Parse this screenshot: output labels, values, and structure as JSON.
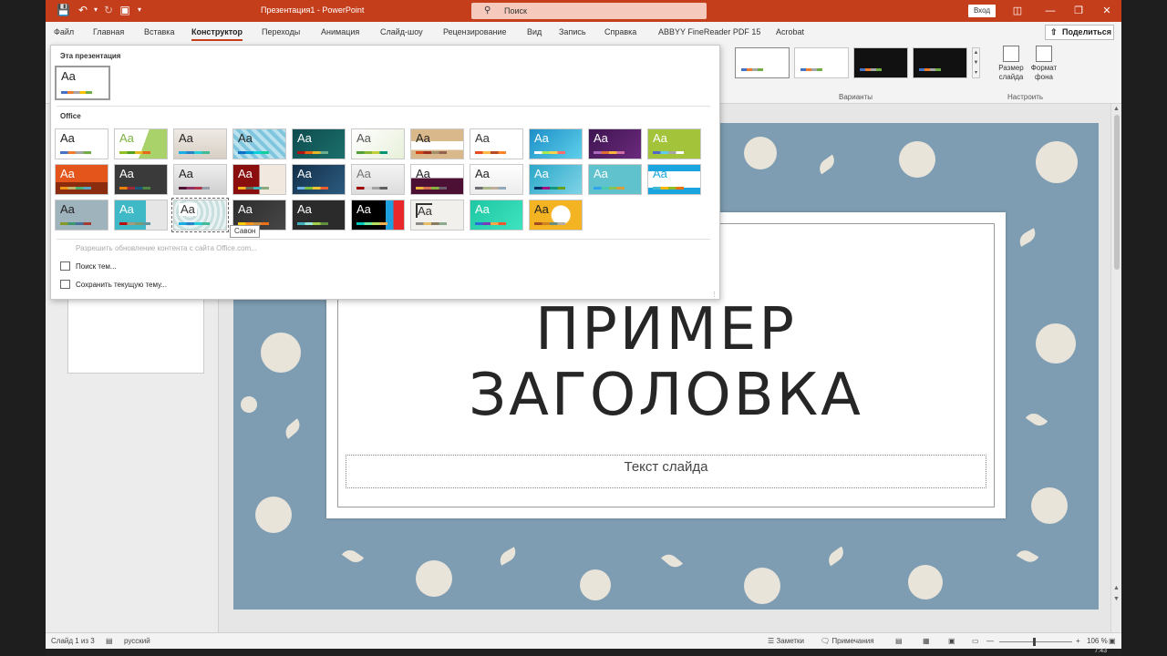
{
  "titlebar": {
    "title": "Презентация1  -  PowerPoint",
    "search_placeholder": "Поиск",
    "login_label": "Вход",
    "accent": "#c43e1c"
  },
  "tabs": [
    {
      "label": "Файл"
    },
    {
      "label": "Главная"
    },
    {
      "label": "Вставка"
    },
    {
      "label": "Конструктор",
      "active": true
    },
    {
      "label": "Переходы"
    },
    {
      "label": "Анимация"
    },
    {
      "label": "Слайд-шоу"
    },
    {
      "label": "Рецензирование"
    },
    {
      "label": "Вид"
    },
    {
      "label": "Запись"
    },
    {
      "label": "Справка"
    },
    {
      "label": "ABBYY FineReader PDF 15"
    },
    {
      "label": "Acrobat"
    }
  ],
  "share_label": "Поделиться",
  "ribbon": {
    "variants_label": "Варианты",
    "customize_label": "Настроить",
    "slide_size_label": "Размер слайда",
    "format_bg_label": "Формат фона"
  },
  "dropdown": {
    "this_presentation_label": "Эта презентация",
    "office_label": "Office",
    "theme_sample": "Aa",
    "enable_updates_label": "Разрешить обновление контента с сайта Office.com...",
    "browse_label": "Поиск тем...",
    "save_label": "Сохранить текущую тему...",
    "tooltip": "Савон"
  },
  "slide": {
    "title_line1": "ПРИМЕР",
    "title_line2": "ЗАГОЛОВКА",
    "subtitle": "Текст слайда"
  },
  "statusbar": {
    "slide_info": "Слайд 1 из 3",
    "language": "русский",
    "notes_label": "Заметки",
    "comments_label": "Примечания",
    "zoom": "106 %"
  },
  "taskbar": {
    "clock": "7:43"
  }
}
